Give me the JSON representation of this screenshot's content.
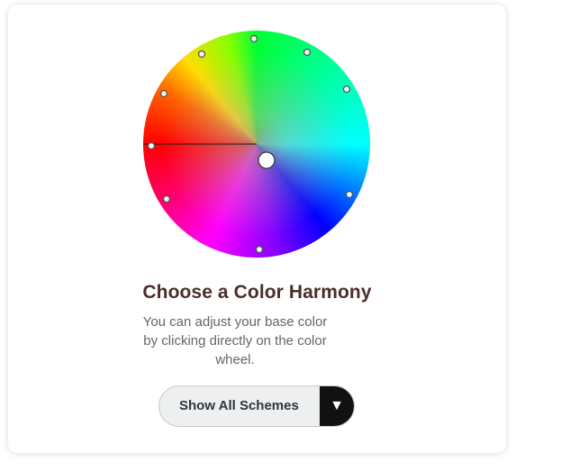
{
  "harmony_panel": {
    "title": "Choose a Color Harmony",
    "description": "You can adjust your base color by clicking directly on the color wheel.",
    "scheme_select": {
      "selected_label": "Show All Schemes",
      "arrow_glyph": "▼"
    }
  },
  "wheel": {
    "icon": "color-wheel",
    "colors": {
      "red": "#ff0000",
      "yellow": "#ffdd00",
      "green": "#00ff33",
      "cyan": "#00ffff",
      "blue": "#0000ff",
      "magenta": "#ff00ff"
    }
  },
  "colors": {
    "title_text": "#4a2e2a",
    "body_text": "#6b6460",
    "select_bg": "#eef0f0",
    "select_arrow_bg": "#111111"
  }
}
